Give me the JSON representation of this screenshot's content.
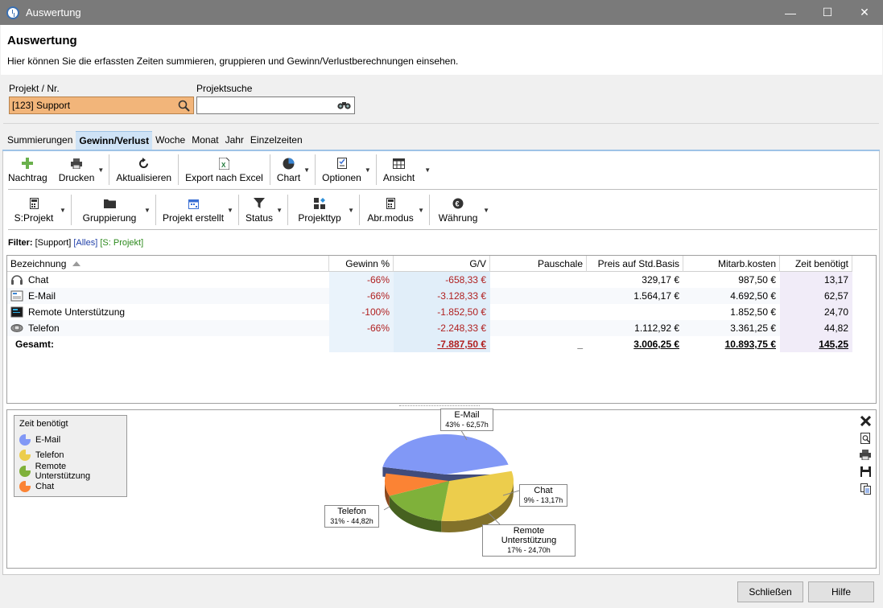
{
  "window": {
    "title": "Auswertung",
    "controls": [
      "—",
      "☐",
      "✕"
    ]
  },
  "header": {
    "title": "Auswertung",
    "subtitle": "Hier können Sie die erfassten Zeiten summieren, gruppieren und Gewinn/Verlustberechnungen einsehen."
  },
  "fields": {
    "project_label": "Projekt / Nr.",
    "project_value": "[123] Support",
    "search_label": "Projektsuche",
    "search_value": ""
  },
  "tabs": [
    "Summierungen",
    "Gewinn/Verlust",
    "Woche",
    "Monat",
    "Jahr",
    "Einzelzeiten"
  ],
  "active_tab": "Gewinn/Verlust",
  "toolbar1": {
    "nachtrag": "Nachtrag",
    "drucken": "Drucken",
    "aktualisieren": "Aktualisieren",
    "export": "Export nach Excel",
    "chart": "Chart",
    "optionen": "Optionen",
    "ansicht": "Ansicht"
  },
  "toolbar2": {
    "sprojekt": "S:Projekt",
    "gruppierung": "Gruppierung",
    "projekt_erstellt": "Projekt erstellt",
    "status": "Status",
    "projekttyp": "Projekttyp",
    "abrmodus": "Abr.modus",
    "waehrung": "Währung"
  },
  "filter": {
    "label": "Filter:",
    "support": "[Support]",
    "alles": "[Alles]",
    "sprojekt": "[S: Projekt]"
  },
  "table": {
    "headers": {
      "bezeichnung": "Bezeichnung",
      "gewinn": "Gewinn %",
      "gv": "G/V",
      "pauschale": "Pauschale",
      "preis": "Preis auf Std.Basis",
      "mitarb": "Mitarb.kosten",
      "zeit": "Zeit benötigt"
    },
    "rows": [
      {
        "name": "Chat",
        "gewinn": "-66%",
        "gv": "-658,33 €",
        "pauschale": "",
        "preis": "329,17 €",
        "mitarb": "987,50 €",
        "zeit": "13,17"
      },
      {
        "name": "E-Mail",
        "gewinn": "-66%",
        "gv": "-3.128,33 €",
        "pauschale": "",
        "preis": "1.564,17 €",
        "mitarb": "4.692,50 €",
        "zeit": "62,57"
      },
      {
        "name": "Remote Unterstützung",
        "gewinn": "-100%",
        "gv": "-1.852,50 €",
        "pauschale": "",
        "preis": "",
        "mitarb": "1.852,50 €",
        "zeit": "24,70"
      },
      {
        "name": "Telefon",
        "gewinn": "-66%",
        "gv": "-2.248,33 €",
        "pauschale": "",
        "preis": "1.112,92 €",
        "mitarb": "3.361,25 €",
        "zeit": "44,82"
      }
    ],
    "total": {
      "label": "Gesamt:",
      "gv": "-7.887,50 €",
      "pauschale": "_",
      "preis": "3.006,25 €",
      "mitarb": "10.893,75 €",
      "zeit": "145,25"
    }
  },
  "chart_data": {
    "type": "pie",
    "title": "Zeit benötigt",
    "categories": [
      "E-Mail",
      "Telefon",
      "Remote Unterstützung",
      "Chat"
    ],
    "values": [
      62.57,
      44.82,
      24.7,
      13.17
    ],
    "labels": [
      "43% - 62,57h",
      "31% - 44,82h",
      "17% - 24,70h",
      "9% - 13,17h"
    ],
    "colors": [
      "#8198f6",
      "#eccd4c",
      "#7fb13a",
      "#fb8334"
    ],
    "legend_position": "top-left",
    "style": "3d"
  },
  "footer": {
    "close": "Schließen",
    "help": "Hilfe"
  }
}
